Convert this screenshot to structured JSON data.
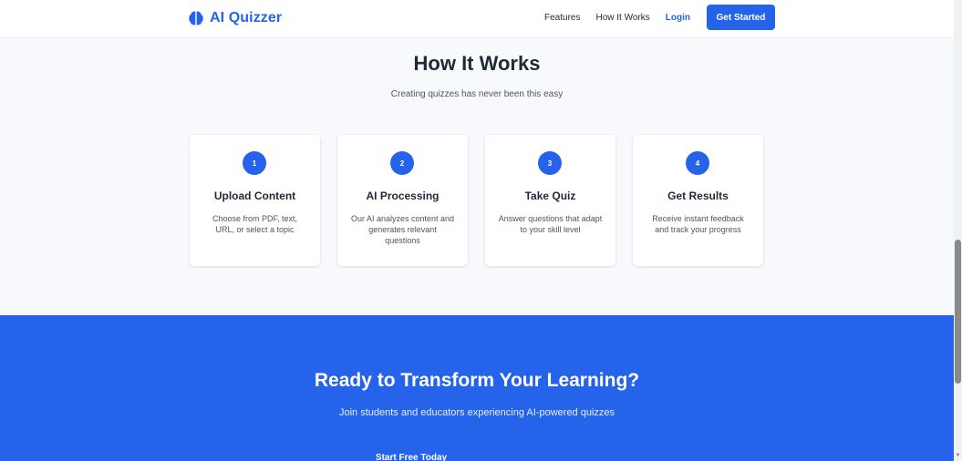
{
  "navbar": {
    "brand": "AI Quizzer",
    "brand_icon": "brain-icon",
    "links": {
      "features": "Features",
      "how_it_works": "How It Works",
      "login": "Login"
    },
    "cta": "Get Started"
  },
  "how_it_works": {
    "title": "How It Works",
    "subtitle": "Creating quizzes has never been this easy",
    "steps": [
      {
        "number": "1",
        "title": "Upload Content",
        "description": "Choose from PDF, text, URL, or select a topic"
      },
      {
        "number": "2",
        "title": "AI Processing",
        "description": "Our AI analyzes content and generates relevant questions"
      },
      {
        "number": "3",
        "title": "Take Quiz",
        "description": "Answer questions that adapt to your skill level"
      },
      {
        "number": "4",
        "title": "Get Results",
        "description": "Receive instant feedback and track your progress"
      }
    ]
  },
  "cta_section": {
    "title": "Ready to Transform Your Learning?",
    "subtitle": "Join students and educators experiencing AI-powered quizzes",
    "button": "Start Free Today"
  },
  "colors": {
    "primary": "#2563eb",
    "section_background": "#f7f9fc",
    "text_dark": "#1f2937",
    "text_muted": "#4b5563"
  }
}
